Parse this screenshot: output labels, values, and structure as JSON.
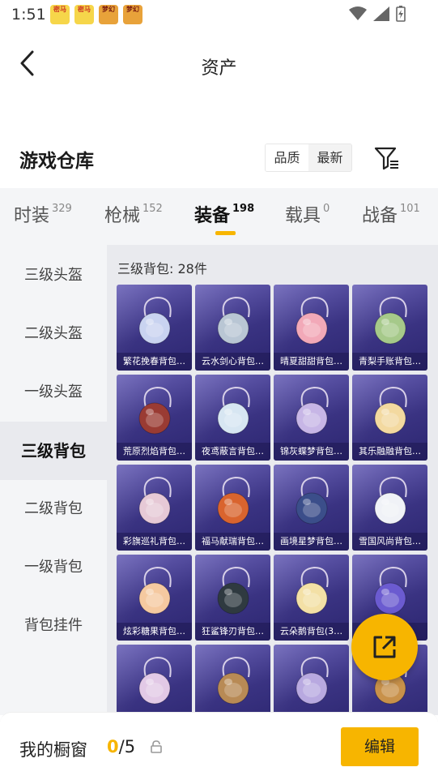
{
  "status_bar": {
    "time": "1:51",
    "notifications": [
      {
        "text": "密马",
        "icon": "app-notification-icon"
      },
      {
        "text": "密马",
        "icon": "app-notification-icon"
      },
      {
        "text": "梦幻",
        "icon": "app-notification-icon"
      },
      {
        "text": "梦幻",
        "icon": "app-notification-icon"
      }
    ]
  },
  "header": {
    "title": "资产",
    "back_icon": "chevron-left-icon"
  },
  "section": {
    "title": "游戏仓库",
    "sort_options": [
      "品质",
      "最新"
    ],
    "filter_icon": "filter-icon"
  },
  "tabs": [
    {
      "label": "时装",
      "count": "329",
      "active": false
    },
    {
      "label": "枪械",
      "count": "152",
      "active": false
    },
    {
      "label": "装备",
      "count": "198",
      "active": true
    },
    {
      "label": "载具",
      "count": "0",
      "active": false
    },
    {
      "label": "战备",
      "count": "101",
      "active": false
    }
  ],
  "sidebar": {
    "items": [
      {
        "label": "三级头盔",
        "active": false
      },
      {
        "label": "二级头盔",
        "active": false
      },
      {
        "label": "一级头盔",
        "active": false
      },
      {
        "label": "三级背包",
        "active": true
      },
      {
        "label": "二级背包",
        "active": false
      },
      {
        "label": "一级背包",
        "active": false
      },
      {
        "label": "背包挂件",
        "active": false
      }
    ]
  },
  "content": {
    "title": "三级背包: 28件",
    "items": [
      {
        "label": "繁花挽春背包…",
        "color": "#c9d3f0"
      },
      {
        "label": "云水剑心背包…",
        "color": "#b9c6d4"
      },
      {
        "label": "晴夏甜甜背包…",
        "color": "#f2a9b8"
      },
      {
        "label": "青梨手账背包…",
        "color": "#a6c98a"
      },
      {
        "label": "荒原烈焰背包…",
        "color": "#9a3b33"
      },
      {
        "label": "夜鸢蔽言背包…",
        "color": "#d7e6f2"
      },
      {
        "label": "锦灰蝶梦背包…",
        "color": "#c7b6e6"
      },
      {
        "label": "其乐融融背包…",
        "color": "#f3d9a0"
      },
      {
        "label": "彩旗巡礼背包…",
        "color": "#e6c9d6"
      },
      {
        "label": "福马献瑞背包…",
        "color": "#d9642e"
      },
      {
        "label": "画境星梦背包…",
        "color": "#3b4e8a"
      },
      {
        "label": "雪国风尚背包…",
        "color": "#f0f2f7"
      },
      {
        "label": "炫彩糖果背包…",
        "color": "#f5c9a0"
      },
      {
        "label": "狂鲨锋刃背包…",
        "color": "#2f3a40"
      },
      {
        "label": "云朵鹅背包(3…",
        "color": "#f3e0a6"
      },
      {
        "label": "",
        "color": "#6b5bd0"
      },
      {
        "label": "",
        "color": "#e2c9e6"
      },
      {
        "label": "",
        "color": "#b88a55"
      },
      {
        "label": "",
        "color": "#b8a9e0"
      },
      {
        "label": "",
        "color": "#c8914a"
      }
    ]
  },
  "fab": {
    "icon": "share-external-icon"
  },
  "bottom_bar": {
    "label": "我的橱窗",
    "current": "0",
    "total": "/5",
    "lock_icon": "lock-icon",
    "edit_label": "编辑"
  },
  "colors": {
    "accent": "#f7b500",
    "card_top": "#6b63b8",
    "card_bottom": "#2c2670"
  }
}
